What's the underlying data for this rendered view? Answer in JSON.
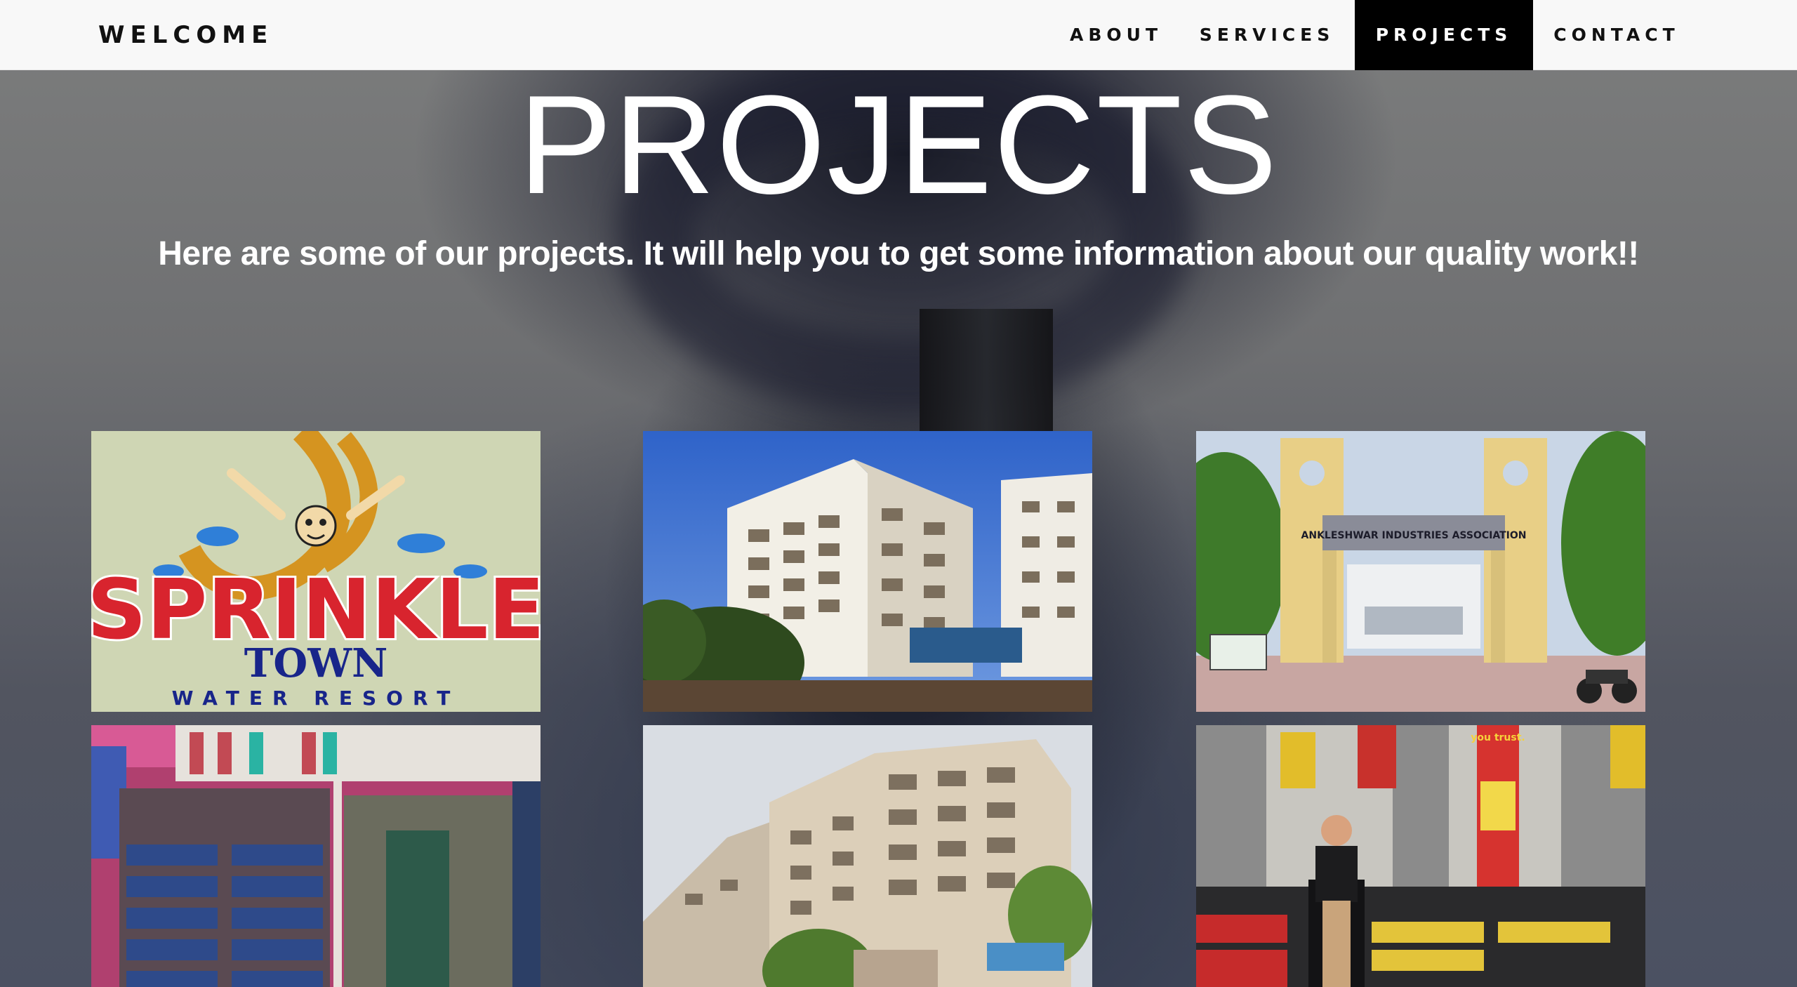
{
  "navbar": {
    "brand": "WELCOME",
    "items": [
      {
        "label": "ABOUT",
        "active": false
      },
      {
        "label": "SERVICES",
        "active": false
      },
      {
        "label": "PROJECTS",
        "active": true
      },
      {
        "label": "CONTACT",
        "active": false
      }
    ]
  },
  "hero": {
    "title": "PROJECTS",
    "subtitle": "Here are some of our projects. It will help you to get some information about our quality work!!"
  },
  "projects": [
    {
      "image": "sprinkle-town-logo",
      "sign_line1": "SPRINKLE",
      "sign_line2": "TOWN",
      "sign_line3": "WATER RESORT"
    },
    {
      "image": "residential-tower-photo"
    },
    {
      "image": "industries-association-gate-photo",
      "sign": "ANKLESHWAR INDUSTRIES ASSOCIATION"
    },
    {
      "image": "garment-shop-interior-photo"
    },
    {
      "image": "apartment-complex-photo"
    },
    {
      "image": "auto-parts-store-photo",
      "sign": "you trust."
    }
  ]
}
